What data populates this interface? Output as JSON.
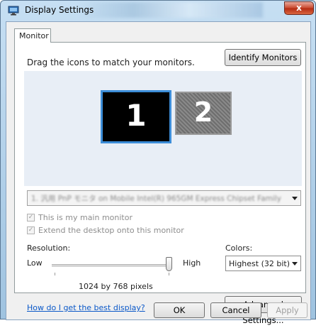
{
  "window": {
    "title": "Display Settings",
    "close_label": "x"
  },
  "tab": {
    "label": "Monitor"
  },
  "instructions": "Drag the icons to match your monitors.",
  "identify_button": "Identify Monitors",
  "monitors": [
    {
      "number": "1",
      "selected": true
    },
    {
      "number": "2",
      "selected": false
    }
  ],
  "display_select": {
    "value": "1. 汎用 PnP モニタ on Mobile Intel(R) 965GM Express Chipset Family"
  },
  "checkboxes": {
    "main_monitor": {
      "label": "This is my main monitor",
      "checked": true,
      "enabled": false
    },
    "extend_desktop": {
      "label": "Extend the desktop onto this monitor",
      "checked": true,
      "enabled": false
    }
  },
  "resolution": {
    "label": "Resolution:",
    "low": "Low",
    "high": "High",
    "value_text": "1024 by 768 pixels",
    "slider_fraction": 1.0
  },
  "colors": {
    "label": "Colors:",
    "value": "Highest (32 bit)"
  },
  "help_link": "How do I get the best display?",
  "advanced_button": "Advanced Settings...",
  "buttons": {
    "ok": "OK",
    "cancel": "Cancel",
    "apply": "Apply"
  },
  "accent_colors": {
    "selected_border": "#3c8dd8",
    "link": "#0a58c8"
  }
}
